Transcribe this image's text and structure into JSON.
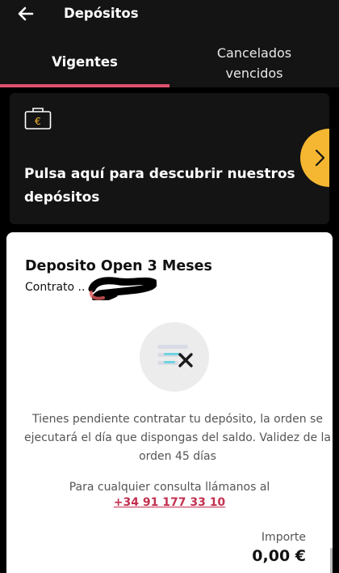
{
  "header": {
    "title": "Depósitos",
    "back_icon": "arrow-left-icon"
  },
  "tabs": {
    "active": {
      "label": "Vigentes"
    },
    "other": {
      "label": "Cancelados\nvencidos"
    },
    "indicator_color": "#e0506e"
  },
  "promo": {
    "icon": "wallet-euro-icon",
    "text": "Pulsa aquí para descubrir nuestros depósitos",
    "arrow_icon": "chevron-right-icon",
    "arrow_color": "#f5b731"
  },
  "deposit": {
    "title": "Deposito Open 3 Meses",
    "contract_label": "Contrato ..",
    "status_icon": "document-cancel-icon",
    "notice": "Tienes pendiente contratar tu depósito, la orden se ejecutará el día que dispongas del saldo. Validez de la orden 45 días",
    "consult_text": "Para cualquier consulta llámanos al",
    "phone": "+34 91 177 33 10",
    "amount_label": "Importe",
    "amount": "0,00 €"
  },
  "colors": {
    "background": "#141414",
    "accent": "#e0506e",
    "link": "#c2304f",
    "yellow": "#f5b731"
  }
}
